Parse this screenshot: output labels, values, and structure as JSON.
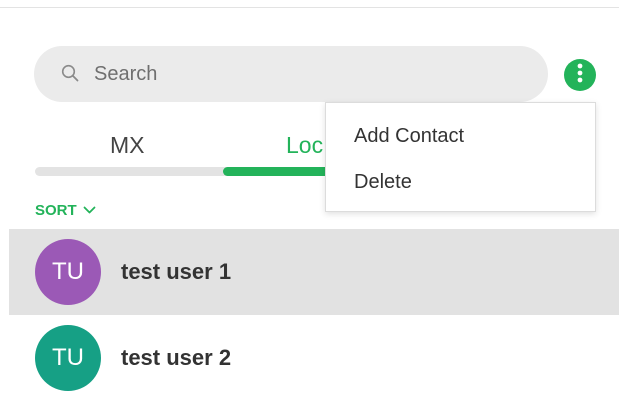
{
  "colors": {
    "accent": "#23b35a",
    "avatar_user1": "#9b59b6",
    "avatar_user2": "#16a085",
    "selected_row": "#e2e2e2"
  },
  "search": {
    "placeholder": "Search",
    "icon": "search-icon"
  },
  "header": {
    "more_icon": "vertical-dots-icon"
  },
  "tabs": [
    {
      "label": "MX"
    },
    {
      "label": "Loc"
    }
  ],
  "sort": {
    "label": "SORT",
    "icon": "chevron-down-icon"
  },
  "contacts": [
    {
      "initials": "TU",
      "name": "test user 1",
      "selected": true
    },
    {
      "initials": "TU",
      "name": "test user 2",
      "selected": false
    }
  ],
  "menu": {
    "items": [
      {
        "label": "Add Contact"
      },
      {
        "label": "Delete"
      }
    ]
  }
}
